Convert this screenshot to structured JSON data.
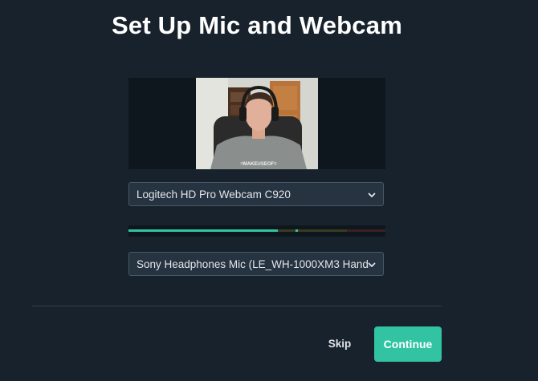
{
  "page": {
    "title": "Set Up Mic and Webcam"
  },
  "webcam_preview": {
    "shirt_text": "=MAKEUSEOF="
  },
  "camera_select": {
    "selected": "Logitech HD Pro Webcam C920",
    "icon": "chevron-down-icon"
  },
  "mic_level_meter": {
    "level": 0.58,
    "peak": 0.65,
    "colors": {
      "fill": "#31c3a2",
      "peak": "#31c3a2",
      "track_green": "#1d3a34",
      "track_yellow": "#3a3a22",
      "track_red": "#3d1f24"
    }
  },
  "mic_select": {
    "selected": "Sony Headphones Mic (LE_WH-1000XM3 Hands",
    "icon": "chevron-down-icon"
  },
  "footer": {
    "skip_label": "Skip",
    "continue_label": "Continue"
  },
  "colors": {
    "background": "#18222c",
    "accent": "#31c3a2",
    "select_bg": "#263340"
  }
}
